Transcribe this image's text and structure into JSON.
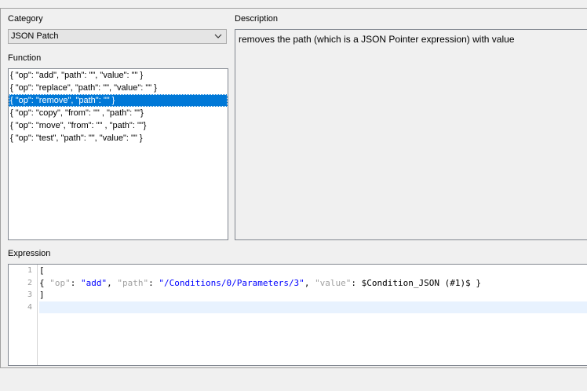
{
  "category": {
    "label": "Category",
    "selected": "JSON Patch"
  },
  "function": {
    "label": "Function",
    "items": [
      "{ \"op\": \"add\", \"path\": \"\", \"value\": \"\" }",
      "{ \"op\": \"replace\", \"path\": \"\", \"value\": \"\" }",
      "{ \"op\": \"remove\", \"path\": \"\" }",
      "{ \"op\": \"copy\", \"from\": \"\" , \"path\": \"\"}",
      "{ \"op\": \"move\", \"from\": \"\" , \"path\": \"\"}",
      "{ \"op\": \"test\", \"path\": \"\", \"value\": \"\" }"
    ],
    "selected_index": 2
  },
  "description": {
    "label": "Description",
    "text": "removes the path (which is a JSON Pointer expression) with value"
  },
  "expression": {
    "label": "Expression",
    "line_numbers": [
      "1",
      "2",
      "3",
      "4"
    ],
    "lines": {
      "l1": "[",
      "l2": {
        "p1": "{ ",
        "k1": "\"op\"",
        "c1": ": ",
        "v1": "\"add\"",
        "c2": ", ",
        "k2": "\"path\"",
        "c3": ": ",
        "v2": "\"/Conditions/0/Parameters/3\"",
        "c4": ", ",
        "k3": "\"value\"",
        "c5": ": ",
        "v3": "$Condition_JSON (#1)$ }"
      },
      "l3": "]",
      "l4": ""
    }
  },
  "colors": {
    "selection": "#0078d7",
    "string": "#0000ff",
    "key": "#a0a0a0",
    "current_line": "#e8f2fe"
  },
  "icons": {
    "combo_arrow": "chevron-down-icon"
  }
}
